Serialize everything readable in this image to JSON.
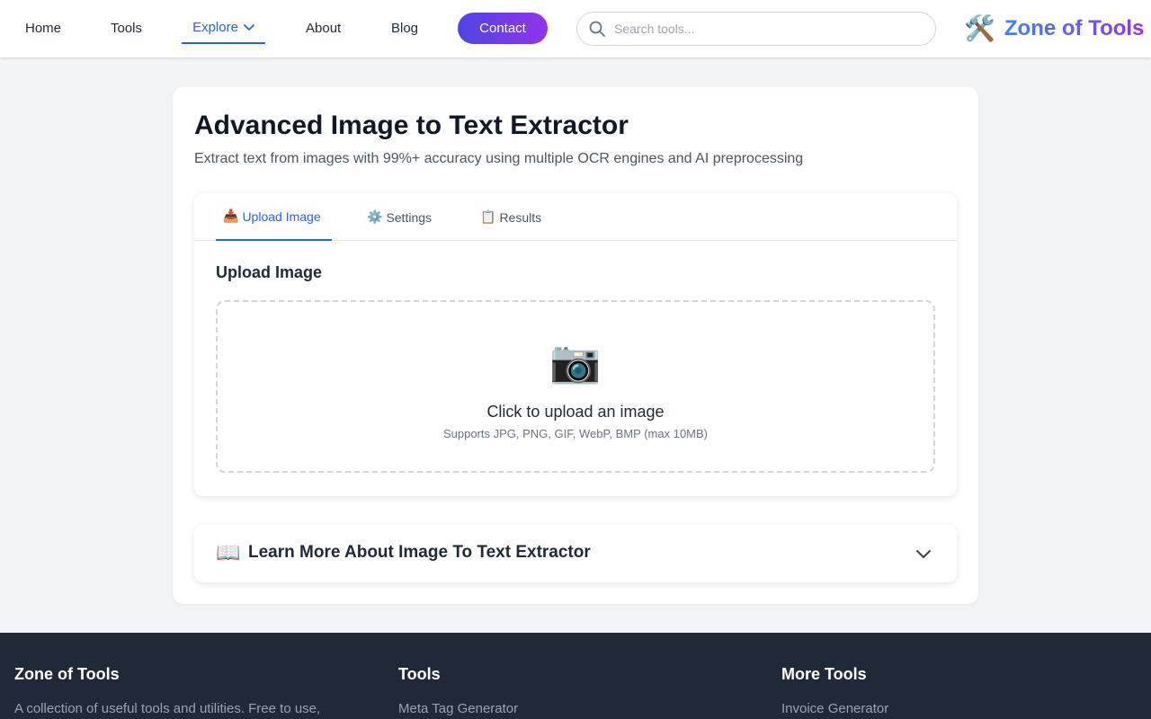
{
  "header": {
    "nav": {
      "home": "Home",
      "tools": "Tools",
      "explore": "Explore",
      "about": "About",
      "blog": "Blog"
    },
    "contact_label": "Contact",
    "search": {
      "placeholder": "Search tools..."
    },
    "brand": {
      "icon": "🛠️",
      "name": "Zone of Tools"
    },
    "accent_color": "#2563eb",
    "contact_gradient": [
      "#4f46e5",
      "#9333ea"
    ]
  },
  "main": {
    "title": "Advanced Image to Text Extractor",
    "subtitle": "Extract text from images with 99%+ accuracy using multiple OCR engines and AI preprocessing",
    "tabs": [
      {
        "icon": "📥",
        "label": "Upload Image",
        "active": true
      },
      {
        "icon": "⚙️",
        "label": "Settings",
        "active": false
      },
      {
        "icon": "📋",
        "label": "Results",
        "active": false
      }
    ],
    "section_heading": "Upload Image",
    "dropzone": {
      "icon": "📷",
      "title": "Click to upload an image",
      "hint": "Supports JPG, PNG, GIF, WebP, BMP (max 10MB)"
    },
    "learn_more": {
      "icon": "📖",
      "title": "Learn More About Image To Text Extractor"
    }
  },
  "footer": {
    "brand_heading": "Zone of Tools",
    "brand_text": "A collection of useful tools and utilities. Free to use,",
    "tools_heading": "Tools",
    "tools_first_link": "Meta Tag Generator",
    "more_heading": "More Tools",
    "more_first_link": "Invoice Generator"
  }
}
